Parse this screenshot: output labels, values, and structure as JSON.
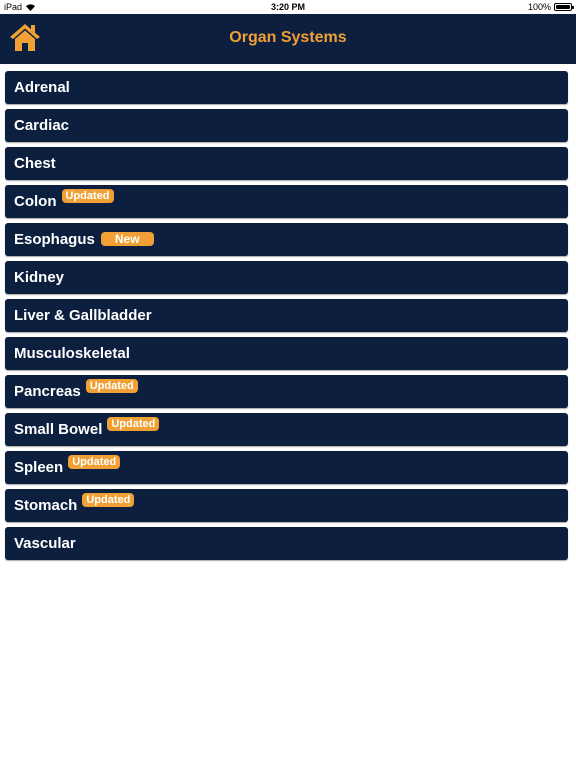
{
  "status_bar": {
    "device": "iPad",
    "time": "3:20 PM",
    "battery": "100%"
  },
  "nav": {
    "title": "Organ Systems",
    "home_icon": "home-icon"
  },
  "colors": {
    "navy": "#0c1f3f",
    "accent": "#f0a034"
  },
  "items": [
    {
      "label": "Adrenal",
      "badge": ""
    },
    {
      "label": "Cardiac",
      "badge": ""
    },
    {
      "label": "Chest",
      "badge": ""
    },
    {
      "label": "Colon",
      "badge": "Updated"
    },
    {
      "label": "Esophagus",
      "badge": "New"
    },
    {
      "label": "Kidney",
      "badge": ""
    },
    {
      "label": "Liver & Gallbladder",
      "badge": ""
    },
    {
      "label": "Musculoskeletal",
      "badge": ""
    },
    {
      "label": "Pancreas",
      "badge": "Updated"
    },
    {
      "label": "Small Bowel",
      "badge": "Updated"
    },
    {
      "label": "Spleen",
      "badge": "Updated"
    },
    {
      "label": "Stomach",
      "badge": "Updated"
    },
    {
      "label": "Vascular",
      "badge": ""
    }
  ]
}
